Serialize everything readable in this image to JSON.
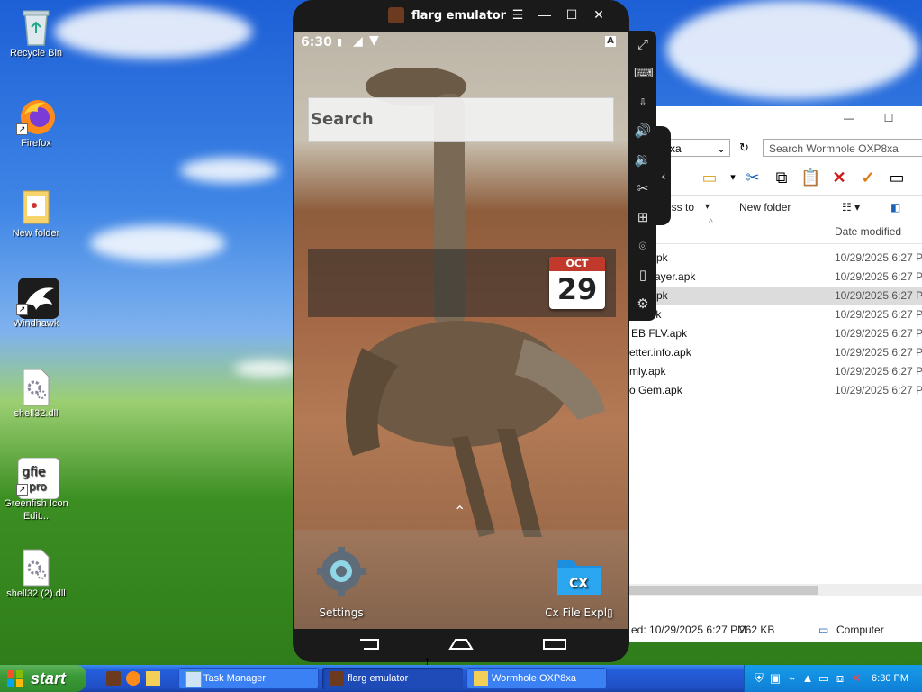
{
  "desktop": {
    "icons": [
      {
        "label": "Recycle Bin"
      },
      {
        "label": "Firefox"
      },
      {
        "label": "New folder"
      },
      {
        "label": "Windhawk"
      },
      {
        "label": "shell32.dll"
      },
      {
        "label": "Greenfish Icon Edit..."
      },
      {
        "label": "shell32 (2).dll"
      }
    ]
  },
  "emulator": {
    "title": "flarg emulator",
    "status_time": "6:30",
    "search_placeholder": "Search",
    "calendar": {
      "month": "OCT",
      "day": "29"
    },
    "apps": [
      {
        "label": "Settings"
      },
      {
        "label": "Cx File Expl▯"
      }
    ]
  },
  "explorer": {
    "address": "xa",
    "search_placeholder": "Search Wormhole OXP8xa",
    "commands": {
      "access": "ess to",
      "new_folder": "New folder"
    },
    "column_date": "Date modified",
    "files": [
      {
        "name": "pk",
        "date": "10/29/2025 6:27 PM"
      },
      {
        "name": "ayer.apk",
        "date": "10/29/2025 6:27 PM"
      },
      {
        "name": "pk",
        "date": "10/29/2025 6:27 PM"
      },
      {
        "name": "d.apk",
        "date": "10/29/2025 6:27 PM"
      },
      {
        "name": "EB FLV.apk",
        "date": "10/29/2025 6:27 PM"
      },
      {
        "name": "etter.info.apk",
        "date": "10/29/2025 6:27 PM"
      },
      {
        "name": "mly.apk",
        "date": "10/29/2025 6:27 PM"
      },
      {
        "name": "o Gem.apk",
        "date": "10/29/2025 6:27 PM"
      }
    ],
    "status": {
      "modified": "ed: 10/29/2025 6:27 PM",
      "size": "262 KB",
      "location": "Computer"
    }
  },
  "taskbar": {
    "start": "start",
    "tasks": [
      {
        "label": "Task Manager"
      },
      {
        "label": "flarg emulator"
      },
      {
        "label": "Wormhole OXP8xa"
      }
    ],
    "clock": "6:30 PM"
  },
  "colors": {
    "taskbar": "#245edb",
    "start": "#3b9a37",
    "emulator_frame": "#1a1a1a"
  }
}
